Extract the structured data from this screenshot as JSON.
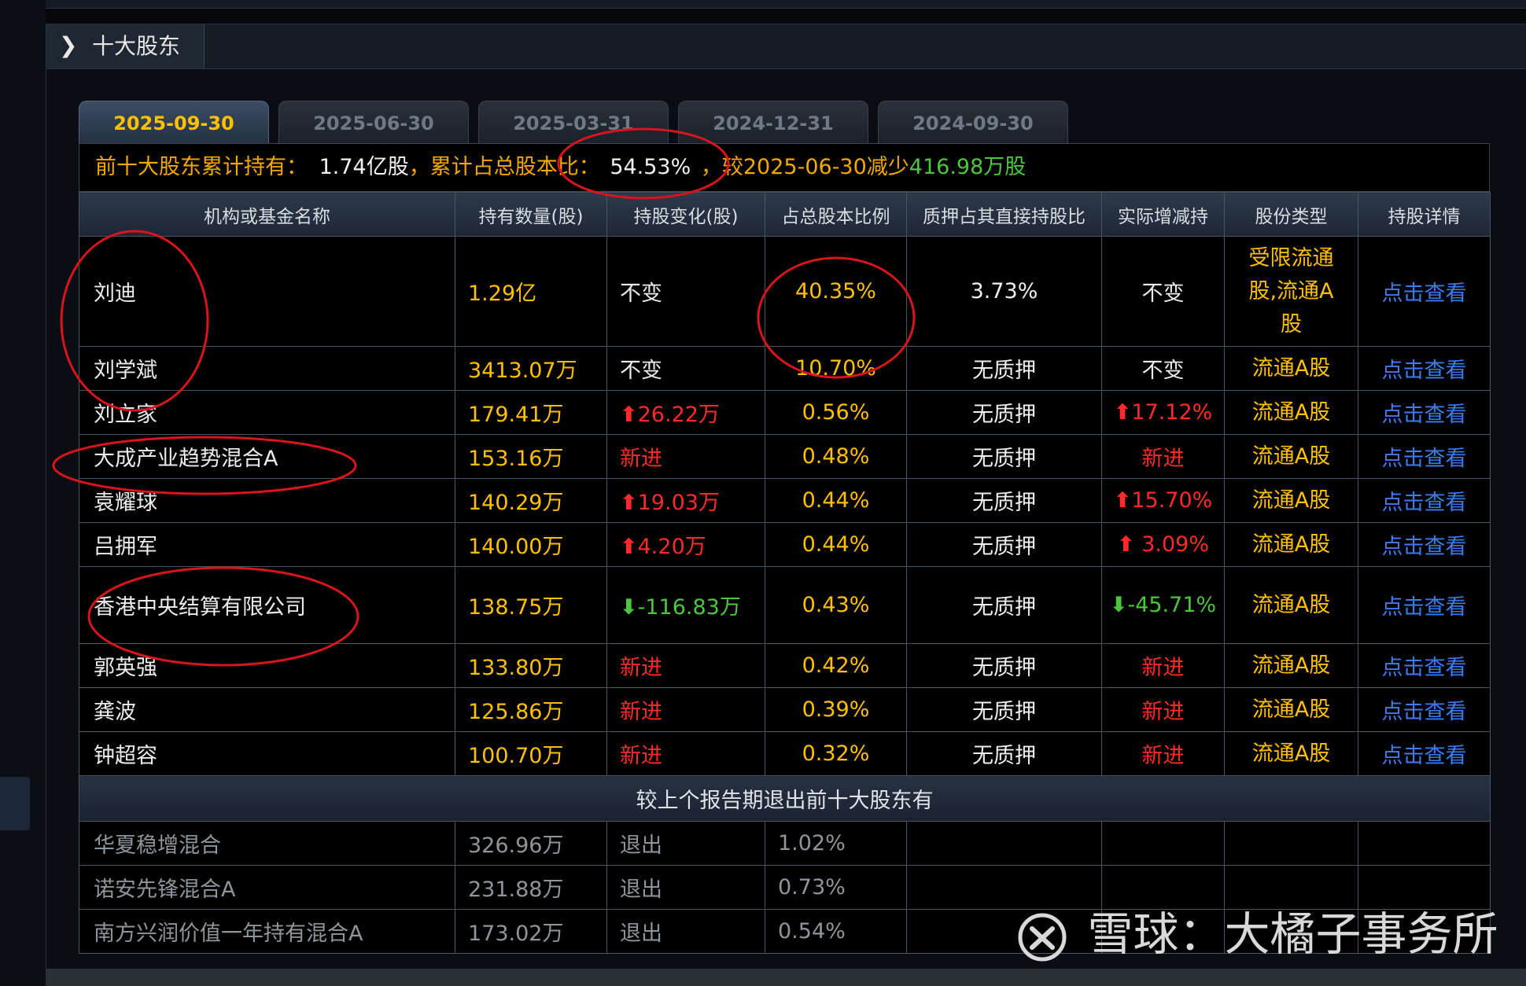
{
  "panel": {
    "title": "十大股东"
  },
  "tabs": [
    {
      "label": "2025-09-30",
      "active": true
    },
    {
      "label": "2025-06-30",
      "active": false
    },
    {
      "label": "2025-03-31",
      "active": false
    },
    {
      "label": "2024-12-31",
      "active": false
    },
    {
      "label": "2024-09-30",
      "active": false
    }
  ],
  "summary": {
    "lead": "前十大股东累计持有：",
    "shares": "1.74亿股",
    "mid": "，累计占总股本比：",
    "ratio": "54.53%",
    "comma": "，",
    "compare": "较2025-06-30减少",
    "delta": "416.98万股"
  },
  "columns": [
    "机构或基金名称",
    "持有数量(股)",
    "持股变化(股)",
    "占总股本比例",
    "质押占其直接持股比",
    "实际增减持",
    "股份类型",
    "持股详情"
  ],
  "rows": [
    {
      "name": "刘迪",
      "holding": "1.29亿",
      "change": "不变",
      "change_dir": "none",
      "ratio": "40.35%",
      "pledge": "3.73%",
      "actual": "不变",
      "actual_dir": "none",
      "type": "受限流通股,流通A股",
      "detail": "点击查看"
    },
    {
      "name": "刘学斌",
      "holding": "3413.07万",
      "change": "不变",
      "change_dir": "none",
      "ratio": "10.70%",
      "pledge": "无质押",
      "actual": "不变",
      "actual_dir": "none",
      "type": "流通A股",
      "detail": "点击查看"
    },
    {
      "name": "刘立家",
      "holding": "179.41万",
      "change": "26.22万",
      "change_dir": "up",
      "ratio": "0.56%",
      "pledge": "无质押",
      "actual": "17.12%",
      "actual_dir": "up",
      "type": "流通A股",
      "detail": "点击查看"
    },
    {
      "name": "大成产业趋势混合A",
      "holding": "153.16万",
      "change": "新进",
      "change_dir": "new",
      "ratio": "0.48%",
      "pledge": "无质押",
      "actual": "新进",
      "actual_dir": "new",
      "type": "流通A股",
      "detail": "点击查看"
    },
    {
      "name": "袁耀球",
      "holding": "140.29万",
      "change": "19.03万",
      "change_dir": "up",
      "ratio": "0.44%",
      "pledge": "无质押",
      "actual": "15.70%",
      "actual_dir": "up",
      "type": "流通A股",
      "detail": "点击查看"
    },
    {
      "name": "吕拥军",
      "holding": "140.00万",
      "change": "4.20万",
      "change_dir": "up",
      "ratio": "0.44%",
      "pledge": "无质押",
      "actual": " 3.09%",
      "actual_dir": "up",
      "type": "流通A股",
      "detail": "点击查看"
    },
    {
      "name": "香港中央结算有限公司",
      "holding": "138.75万",
      "change": "-116.83万",
      "change_dir": "down",
      "ratio": "0.43%",
      "pledge": "无质押",
      "actual": "-45.71%",
      "actual_dir": "down",
      "type": "流通A股",
      "detail": "点击查看"
    },
    {
      "name": "郭英强",
      "holding": "133.80万",
      "change": "新进",
      "change_dir": "new",
      "ratio": "0.42%",
      "pledge": "无质押",
      "actual": "新进",
      "actual_dir": "new",
      "type": "流通A股",
      "detail": "点击查看"
    },
    {
      "name": "龚波",
      "holding": "125.86万",
      "change": "新进",
      "change_dir": "new",
      "ratio": "0.39%",
      "pledge": "无质押",
      "actual": "新进",
      "actual_dir": "new",
      "type": "流通A股",
      "detail": "点击查看"
    },
    {
      "name": "钟超容",
      "holding": "100.70万",
      "change": "新进",
      "change_dir": "new",
      "ratio": "0.32%",
      "pledge": "无质押",
      "actual": "新进",
      "actual_dir": "new",
      "type": "流通A股",
      "detail": "点击查看"
    }
  ],
  "exited_title": "较上个报告期退出前十大股东有",
  "exited": [
    {
      "name": "华夏稳增混合",
      "holding": "326.96万",
      "change": "退出",
      "ratio": "1.02%"
    },
    {
      "name": "诺安先锋混合A",
      "holding": "231.88万",
      "change": "退出",
      "ratio": "0.73%"
    },
    {
      "name": "南方兴润价值一年持有混合A",
      "holding": "173.02万",
      "change": "退出",
      "ratio": "0.54%"
    }
  ],
  "watermark": {
    "site": "雪球",
    "sep": "：",
    "author": "大橘子事务所"
  },
  "colors": {
    "highlight": "#ffc000",
    "increase": "#ff2a2a",
    "decrease": "#4dc63e",
    "link": "#3d7cf0",
    "annotation": "#d8141c"
  }
}
